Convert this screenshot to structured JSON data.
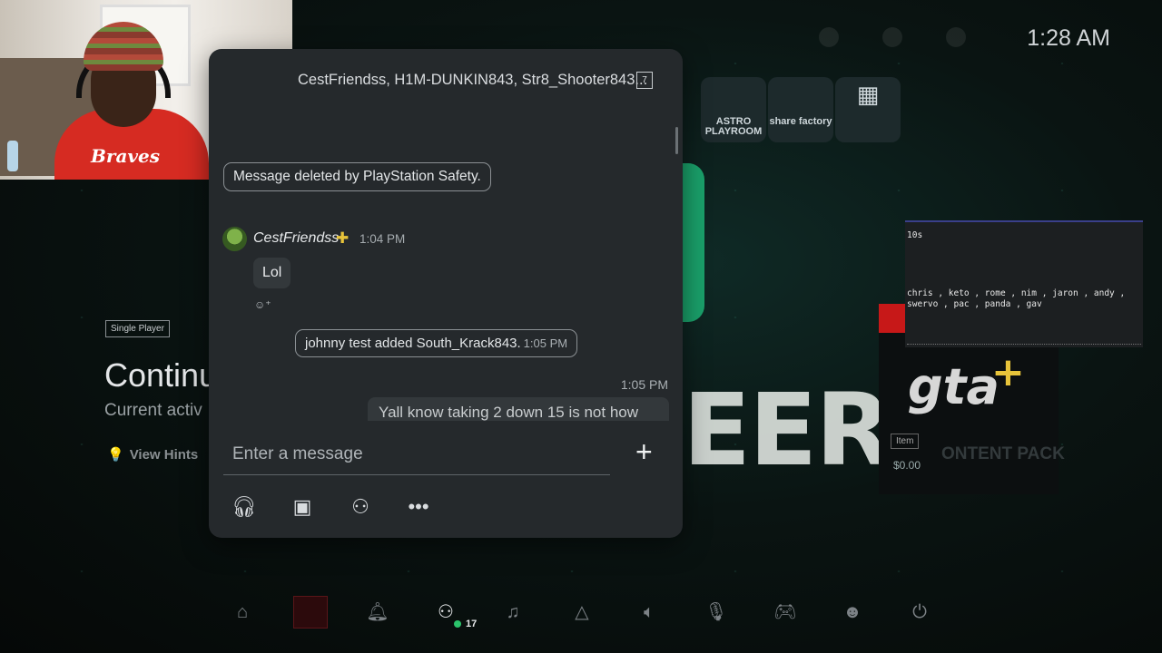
{
  "clock": "1:28 AM",
  "tiles": [
    {
      "label": "ASTRO PLAYROOM"
    },
    {
      "label": "share factory"
    },
    {
      "label": ""
    }
  ],
  "game_panel": {
    "badge": "Single Player",
    "title": "Continu",
    "subtitle": "Current activ",
    "hints": "View Hints"
  },
  "background_text": "EER",
  "gta_card": {
    "logo": "gta",
    "plus": "+",
    "item_tag": "Item",
    "price": "$0.00",
    "content": "ONTENT PACK"
  },
  "terminal": {
    "line1": "10s",
    "line2": "chris , keto , rome , nim , jaron , andy ,",
    "line3": "swervo , pac , panda , gav"
  },
  "webcam": {
    "shirt_text": "Braves"
  },
  "chat": {
    "title": "CestFriendss, H1M-DUNKIN843, Str8_Shooter843...",
    "member_count": "7",
    "deleted_notice": "Message deleted by PlayStation Safety.",
    "sender": "CestFriendss",
    "sender_time": "1:04 PM",
    "message_lol": "Lol",
    "added_notice": "johnny test added South_Krack843.",
    "added_time": "1:05 PM",
    "own_time": "1:05 PM",
    "own_message": "Yall know taking 2 down 15 is not how",
    "compose_placeholder": "Enter a message"
  },
  "control_bar": {
    "friends_count": "17"
  }
}
